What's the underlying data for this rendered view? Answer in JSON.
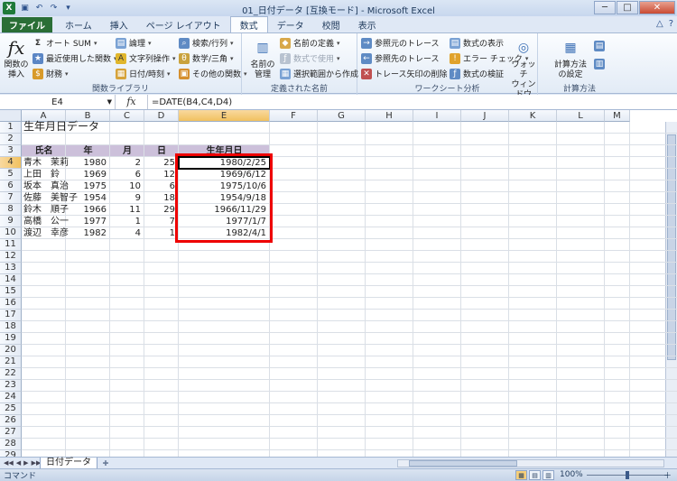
{
  "window": {
    "title": "01_日付データ [互換モード] - Microsoft Excel",
    "logo": "X",
    "qat_icons": [
      "save-icon",
      "undo-icon",
      "redo-icon",
      "customize-icon"
    ]
  },
  "ribbon_tabs": [
    {
      "label": "ファイル",
      "kind": "file"
    },
    {
      "label": "ホーム"
    },
    {
      "label": "挿入"
    },
    {
      "label": "ページ レイアウト"
    },
    {
      "label": "数式",
      "active": true
    },
    {
      "label": "データ"
    },
    {
      "label": "校閲"
    },
    {
      "label": "表示"
    }
  ],
  "ribbon": {
    "func_insert": {
      "line1": "関数の",
      "line2": "挿入",
      "icon": "fx"
    },
    "autosum": "オート SUM",
    "recent": "最近使用した関数",
    "finance": "財務",
    "logical": "論理",
    "text": "文字列操作",
    "datetime": "日付/時刻",
    "lookup": "検索/行列",
    "math": "数学/三角",
    "more": "その他の関数",
    "group_library": "関数ライブラリ",
    "name_mgr": {
      "line1": "名前の",
      "line2": "管理"
    },
    "define_name": "名前の定義",
    "use_in_formula": "数式で使用",
    "create_from_sel": "選択範囲から作成",
    "group_names": "定義された名前",
    "trace_precedents": "参照元のトレース",
    "trace_dependents": "参照先のトレース",
    "remove_arrows": "トレース矢印の削除",
    "show_formulas": "数式の表示",
    "error_check": "エラー チェック",
    "evaluate": "数式の検証",
    "watch": {
      "line1": "ウォッチ",
      "line2": "ウィンドウ"
    },
    "group_audit": "ワークシート分析",
    "calc_options": {
      "line1": "計算方法",
      "line2": "の設定"
    },
    "group_calc": "計算方法"
  },
  "formula_bar": {
    "name_box": "E4",
    "fx": "fx",
    "formula": "=DATE(B4,C4,D4)"
  },
  "columns": [
    "A",
    "B",
    "C",
    "D",
    "E",
    "F",
    "G",
    "H",
    "I",
    "J",
    "K",
    "L",
    "M"
  ],
  "rows": [
    "1",
    "2",
    "3",
    "4",
    "5",
    "6",
    "7",
    "8",
    "9",
    "10",
    "11",
    "12",
    "13",
    "14",
    "15",
    "16",
    "17",
    "18",
    "19",
    "20",
    "21",
    "22",
    "23",
    "24",
    "25",
    "26",
    "27",
    "28",
    "29"
  ],
  "sheet": {
    "title": "生年月日データ",
    "headers": [
      "氏名",
      "年",
      "月",
      "日",
      "生年月日"
    ],
    "data": [
      [
        "青木　茉莉",
        "1980",
        "2",
        "25",
        "1980/2/25"
      ],
      [
        "上田　鈴",
        "1969",
        "6",
        "12",
        "1969/6/12"
      ],
      [
        "坂本　真治",
        "1975",
        "10",
        "6",
        "1975/10/6"
      ],
      [
        "佐藤　美智子",
        "1954",
        "9",
        "18",
        "1954/9/18"
      ],
      [
        "鈴木　順子",
        "1966",
        "11",
        "29",
        "1966/11/29"
      ],
      [
        "高橋　公一",
        "1977",
        "1",
        "7",
        "1977/1/7"
      ],
      [
        "渡辺　幸彦",
        "1982",
        "4",
        "1",
        "1982/4/1"
      ]
    ]
  },
  "sheet_tabs": [
    "日付データ"
  ],
  "status": {
    "mode": "コマンド",
    "zoom": "100%",
    "minus": "－",
    "plus": "＋"
  }
}
